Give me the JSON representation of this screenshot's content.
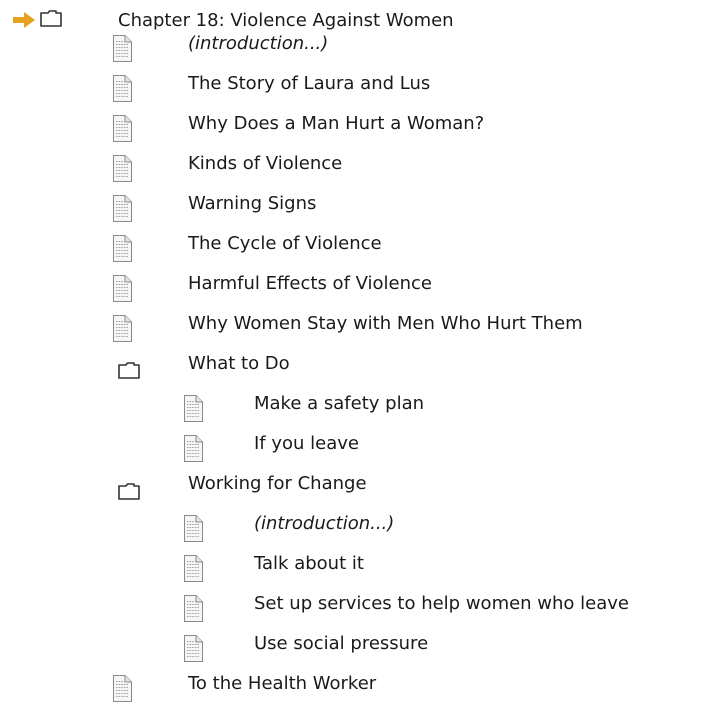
{
  "tree": {
    "root": {
      "label": "Chapter 18: Violence Against Women",
      "icon": "folder-icon",
      "current_marker": "arrow-icon"
    },
    "items": [
      {
        "label": "(introduction...)",
        "icon": "document-icon",
        "italic": true
      },
      {
        "label": "The Story of Laura and Lus",
        "icon": "document-icon"
      },
      {
        "label": "Why Does a Man Hurt a Woman?",
        "icon": "document-icon"
      },
      {
        "label": "Kinds of Violence",
        "icon": "document-icon"
      },
      {
        "label": "Warning Signs",
        "icon": "document-icon"
      },
      {
        "label": "The Cycle of Violence",
        "icon": "document-icon"
      },
      {
        "label": "Harmful Effects of Violence",
        "icon": "document-icon"
      },
      {
        "label": "Why Women Stay with Men Who Hurt Them",
        "icon": "document-icon"
      },
      {
        "label": "What to Do",
        "icon": "folder-icon"
      },
      {
        "label": "Make a safety plan",
        "icon": "document-icon"
      },
      {
        "label": "If you leave",
        "icon": "document-icon"
      },
      {
        "label": "Working for Change",
        "icon": "folder-icon"
      },
      {
        "label": "(introduction...)",
        "icon": "document-icon",
        "italic": true
      },
      {
        "label": "Talk about it",
        "icon": "document-icon"
      },
      {
        "label": "Set up services to help women who leave",
        "icon": "document-icon"
      },
      {
        "label": "Use social pressure",
        "icon": "document-icon"
      },
      {
        "label": "To the Health Worker",
        "icon": "document-icon"
      }
    ]
  },
  "colors": {
    "arrow": "#e8a020",
    "folder_stroke": "#333333",
    "text": "#1a1a1a"
  }
}
